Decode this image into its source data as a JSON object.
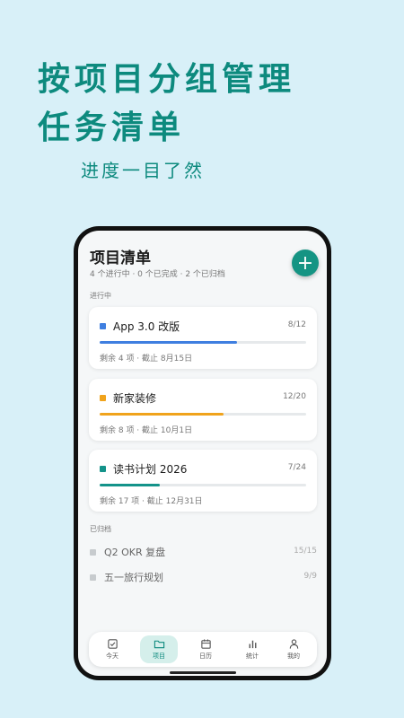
{
  "promo": {
    "headline_line1": "按项目分组管理",
    "headline_line2": "任务清单",
    "subline": "进度一目了然"
  },
  "screen": {
    "title": "项目清单",
    "summary": "4 个进行中 · 0 个已完成 · 2 个已归档",
    "fab_label": "+",
    "active_section": "进行中",
    "archived_section": "已归档"
  },
  "projects": [
    {
      "name": "App 3.0 改版",
      "count": "8/12",
      "meta": "剩余 4 项 · 截止 8月15日",
      "color": "#3f7fe0",
      "progress": 0.667
    },
    {
      "name": "新家装修",
      "count": "12/20",
      "meta": "剩余 8 项 · 截止 10月1日",
      "color": "#f0a31c",
      "progress": 0.6
    },
    {
      "name": "读书计划 2026",
      "count": "7/24",
      "meta": "剩余 17 项 · 截止 12月31日",
      "color": "#14938a",
      "progress": 0.292
    }
  ],
  "archived": [
    {
      "name": "Q2 OKR 复盘",
      "count": "15/15"
    },
    {
      "name": "五一旅行规划",
      "count": "9/9"
    }
  ],
  "tabs": [
    {
      "label": "今天",
      "icon": "checkbox-icon"
    },
    {
      "label": "项目",
      "icon": "folder-icon",
      "active": true
    },
    {
      "label": "日历",
      "icon": "calendar-icon"
    },
    {
      "label": "统计",
      "icon": "bar-chart-icon"
    },
    {
      "label": "我的",
      "icon": "person-icon"
    }
  ]
}
